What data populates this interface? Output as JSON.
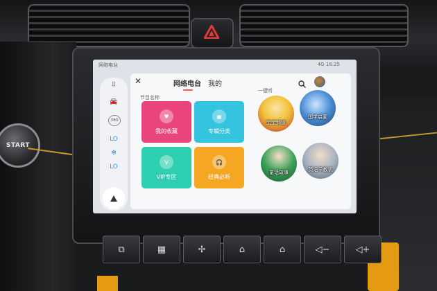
{
  "status_bar": {
    "left": "网络电台",
    "right": "4G 16:25"
  },
  "car": {
    "start_label": "START"
  },
  "rail": {
    "items": [
      {
        "name": "apps-grid-icon",
        "glyph": "⠿"
      },
      {
        "name": "car-icon",
        "glyph": "🚘"
      },
      {
        "name": "camera-360",
        "glyph": "360"
      },
      {
        "name": "temp-left",
        "glyph": "LO"
      },
      {
        "name": "fan-icon",
        "glyph": "✻"
      },
      {
        "name": "temp-right",
        "glyph": "LO"
      }
    ]
  },
  "header": {
    "close_glyph": "✕",
    "tabs": [
      {
        "label": "网络电台"
      },
      {
        "label": "我的"
      }
    ],
    "search_icon": "search-icon",
    "accent": "#f05a5a"
  },
  "sections": {
    "program_names": "节目名称",
    "one_click": "一键听"
  },
  "tiles": [
    {
      "label": "我的收藏",
      "glyph": "♥",
      "color": "#e9457c"
    },
    {
      "label": "专辑分类",
      "glyph": "▣",
      "color": "#35c4df"
    },
    {
      "label": "VIP专区",
      "glyph": "V",
      "color": "#2ecfb0"
    },
    {
      "label": "经典必听",
      "glyph": "🎧",
      "color": "#f5a623"
    }
  ],
  "circles": [
    {
      "label": "宝宝频道",
      "color": "#f2c23a"
    },
    {
      "label": "国学启蒙",
      "color": "#4a8ed6"
    },
    {
      "label": "童话故事",
      "color": "#3aa057"
    },
    {
      "label": "英语早教机",
      "color": "#a8b4c2"
    }
  ],
  "hard_buttons": [
    {
      "name": "rear-defrost-button",
      "glyph": "⧉"
    },
    {
      "name": "front-defrost-button",
      "glyph": "▦"
    },
    {
      "name": "fan-button",
      "glyph": "✢"
    },
    {
      "name": "seat-heat-button",
      "glyph": "⌂"
    },
    {
      "name": "home-button",
      "glyph": "⌂"
    },
    {
      "name": "volume-down-button",
      "glyph": "◁−"
    },
    {
      "name": "volume-up-button",
      "glyph": "◁+"
    }
  ]
}
